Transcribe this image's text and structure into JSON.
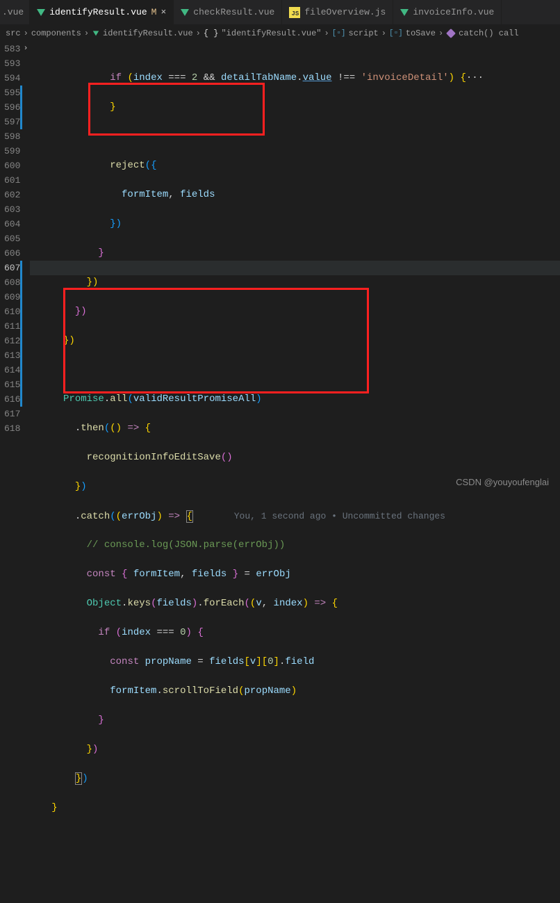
{
  "tabs": {
    "t0": ".vue",
    "t1_label": "identifyResult.vue",
    "t1_mod": "M",
    "t1_close": "×",
    "t2_label": "checkResult.vue",
    "t3_js": "JS",
    "t3_label": "fileOverview.js",
    "t4_label": "invoiceInfo.vue"
  },
  "bc": {
    "b0": "src",
    "b1": "components",
    "b2": "identifyResult.vue",
    "b3_braces": "{ }",
    "b3": "\"identifyResult.vue\"",
    "b4": "script",
    "b5": "toSave",
    "b6": "catch() call",
    "sep": "›"
  },
  "ln": {
    "l583": "583",
    "l593": "593",
    "l594": "594",
    "l595": "595",
    "l596": "596",
    "l597": "597",
    "l598": "598",
    "l599": "599",
    "l600": "600",
    "l601": "601",
    "l602": "602",
    "l603": "603",
    "l604": "604",
    "l605": "605",
    "l606": "606",
    "l607": "607",
    "l608": "608",
    "l609": "609",
    "l610": "610",
    "l611": "611",
    "l612": "612",
    "l613": "613",
    "l614": "614",
    "l615": "615",
    "l616": "616",
    "l617": "617",
    "l618": "618",
    "fold": "›"
  },
  "c": {
    "if": "if",
    "reject": "reject",
    "formItem": "formItem",
    "fields": "fields",
    "Promise": "Promise",
    "all": "all",
    "validResultPromiseAll": "validResultPromiseAll",
    "then": "then",
    "recognitionInfoEditSave": "recognitionInfoEditSave",
    "catch": "catch",
    "errObj": "errObj",
    "comment": "// console.log(JSON.parse(errObj))",
    "const": "const",
    "Object": "Object",
    "keys": "keys",
    "forEach": "forEach",
    "v": "v",
    "index": "index",
    "zero": "0",
    "two": "2",
    "propName": "propName",
    "field": "field",
    "scrollToField": "scrollToField",
    "detailTabName": "detailTabName",
    "value": "value",
    "invoiceDetail": "'invoiceDetail'",
    "and": "&&",
    "neq": "!==",
    "eqq": "===",
    "arrow": "=>",
    "dots": "···",
    "blame": "You, 1 second ago • Uncommitted changes"
  },
  "wm": "CSDN @youyoufenglai"
}
